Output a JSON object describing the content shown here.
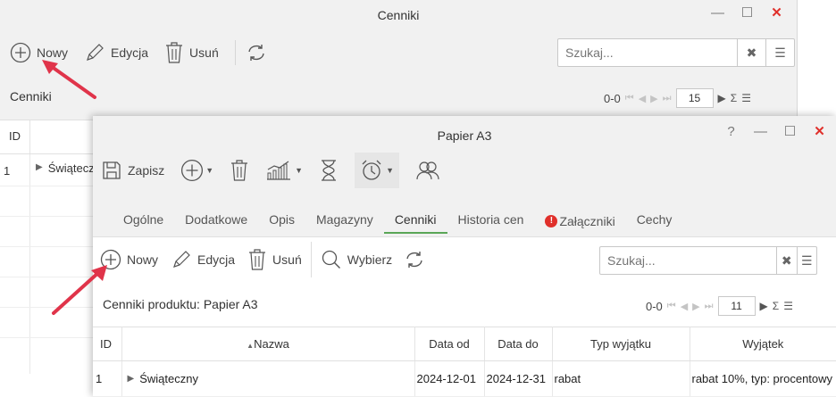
{
  "back_window": {
    "title": "Cenniki",
    "toolbar": {
      "new_label": "Nowy",
      "edit_label": "Edycja",
      "delete_label": "Usuń"
    },
    "search": {
      "placeholder": "Szukaj..."
    },
    "section_title": "Cenniki",
    "pager": {
      "range": "0-0",
      "page_size": "15"
    },
    "table": {
      "headers": [
        "ID"
      ],
      "rows": [
        {
          "id": "1",
          "name": "Świątecz"
        }
      ]
    }
  },
  "front_window": {
    "title": "Papier A3",
    "help_symbol": "?",
    "toolbar": {
      "save_label": "Zapisz"
    },
    "tabs": [
      "Ogólne",
      "Dodatkowe",
      "Opis",
      "Magazyny",
      "Cenniki",
      "Historia cen",
      "Załączniki",
      "Cechy"
    ],
    "active_tab": "Cenniki",
    "attachment_alert": "!",
    "sub_toolbar": {
      "new_label": "Nowy",
      "edit_label": "Edycja",
      "delete_label": "Usuń",
      "select_label": "Wybierz"
    },
    "search": {
      "placeholder": "Szukaj..."
    },
    "section_title": "Cenniki produktu: Papier A3",
    "pager": {
      "range": "0-0",
      "page_size": "11"
    },
    "table": {
      "headers": {
        "id": "ID",
        "name": "Nazwa",
        "date_from": "Data od",
        "date_to": "Data do",
        "exception_type": "Typ wyjątku",
        "exception": "Wyjątek"
      },
      "sort_indicator": "▲",
      "rows": [
        {
          "id": "1",
          "name": "Świąteczny",
          "date_from": "2024-12-01",
          "date_to": "2024-12-31",
          "exception_type": "rabat",
          "exception": "rabat 10%, typ: procentowy"
        }
      ]
    }
  },
  "colors": {
    "arrow": "#e0344a",
    "active_tab": "#5aa657",
    "close": "#e0302b",
    "alert": "#e0302b"
  }
}
